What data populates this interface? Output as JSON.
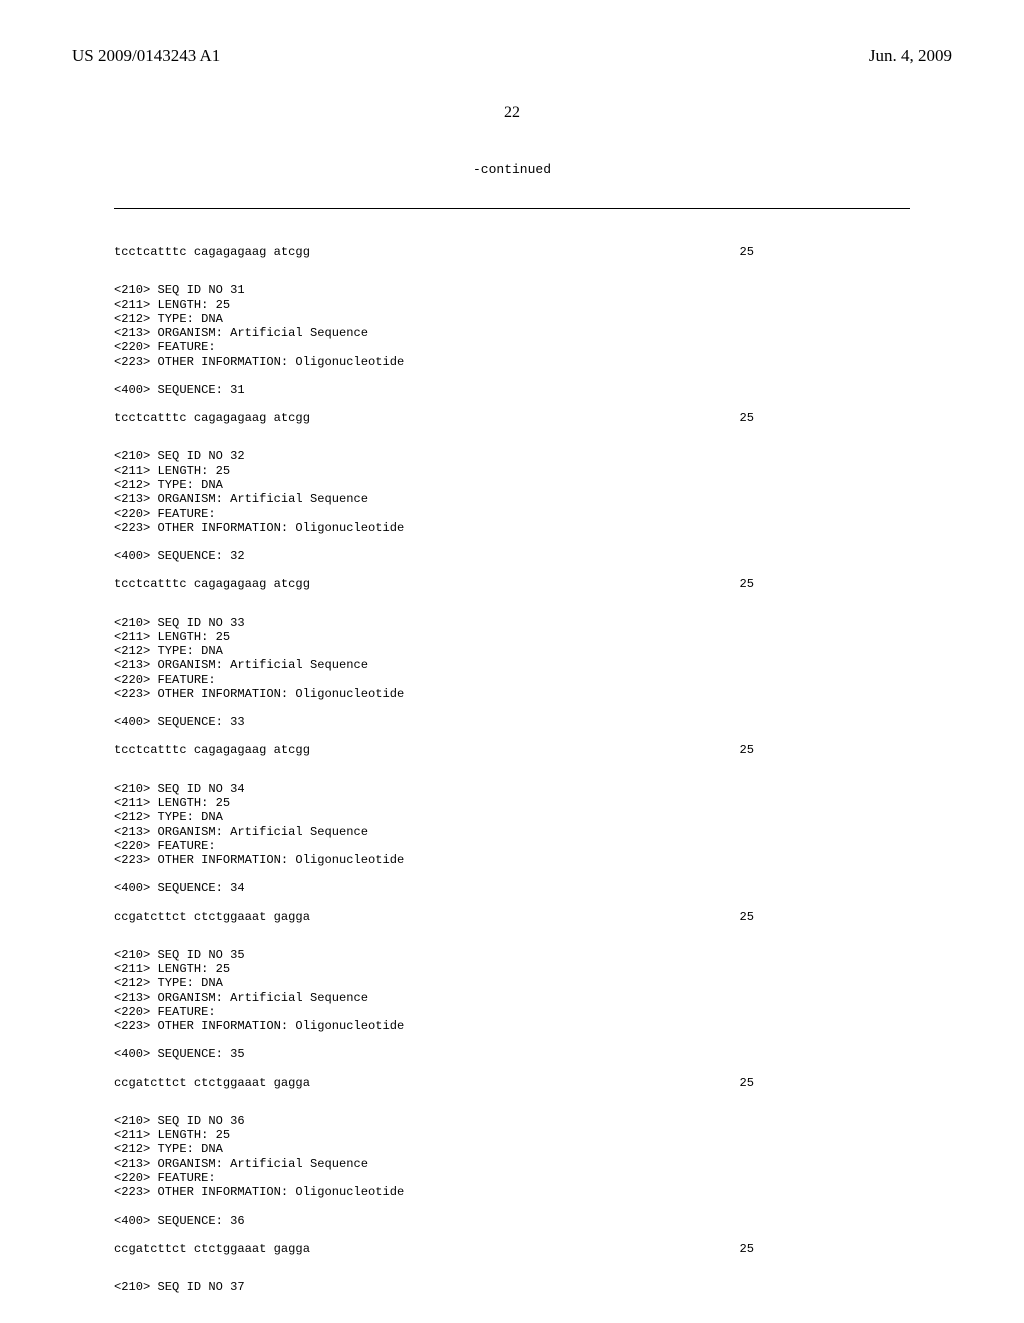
{
  "header": {
    "pubno": "US 2009/0143243 A1",
    "pubdate": "Jun. 4, 2009"
  },
  "page_number": "22",
  "continued_label": "-continued",
  "entries": [
    {
      "type": "seq",
      "sequence": "tcctcatttc cagagagaag atcgg",
      "length": "25"
    },
    {
      "type": "gap"
    },
    {
      "type": "meta",
      "lines": [
        "<210> SEQ ID NO 31",
        "<211> LENGTH: 25",
        "<212> TYPE: DNA",
        "<213> ORGANISM: Artificial Sequence",
        "<220> FEATURE:",
        "<223> OTHER INFORMATION: Oligonucleotide"
      ]
    },
    {
      "type": "smallgap"
    },
    {
      "type": "line",
      "text": "<400> SEQUENCE: 31"
    },
    {
      "type": "smallgap"
    },
    {
      "type": "seq",
      "sequence": "tcctcatttc cagagagaag atcgg",
      "length": "25"
    },
    {
      "type": "gap"
    },
    {
      "type": "meta",
      "lines": [
        "<210> SEQ ID NO 32",
        "<211> LENGTH: 25",
        "<212> TYPE: DNA",
        "<213> ORGANISM: Artificial Sequence",
        "<220> FEATURE:",
        "<223> OTHER INFORMATION: Oligonucleotide"
      ]
    },
    {
      "type": "smallgap"
    },
    {
      "type": "line",
      "text": "<400> SEQUENCE: 32"
    },
    {
      "type": "smallgap"
    },
    {
      "type": "seq",
      "sequence": "tcctcatttc cagagagaag atcgg",
      "length": "25"
    },
    {
      "type": "gap"
    },
    {
      "type": "meta",
      "lines": [
        "<210> SEQ ID NO 33",
        "<211> LENGTH: 25",
        "<212> TYPE: DNA",
        "<213> ORGANISM: Artificial Sequence",
        "<220> FEATURE:",
        "<223> OTHER INFORMATION: Oligonucleotide"
      ]
    },
    {
      "type": "smallgap"
    },
    {
      "type": "line",
      "text": "<400> SEQUENCE: 33"
    },
    {
      "type": "smallgap"
    },
    {
      "type": "seq",
      "sequence": "tcctcatttc cagagagaag atcgg",
      "length": "25"
    },
    {
      "type": "gap"
    },
    {
      "type": "meta",
      "lines": [
        "<210> SEQ ID NO 34",
        "<211> LENGTH: 25",
        "<212> TYPE: DNA",
        "<213> ORGANISM: Artificial Sequence",
        "<220> FEATURE:",
        "<223> OTHER INFORMATION: Oligonucleotide"
      ]
    },
    {
      "type": "smallgap"
    },
    {
      "type": "line",
      "text": "<400> SEQUENCE: 34"
    },
    {
      "type": "smallgap"
    },
    {
      "type": "seq",
      "sequence": "ccgatcttct ctctggaaat gagga",
      "length": "25"
    },
    {
      "type": "gap"
    },
    {
      "type": "meta",
      "lines": [
        "<210> SEQ ID NO 35",
        "<211> LENGTH: 25",
        "<212> TYPE: DNA",
        "<213> ORGANISM: Artificial Sequence",
        "<220> FEATURE:",
        "<223> OTHER INFORMATION: Oligonucleotide"
      ]
    },
    {
      "type": "smallgap"
    },
    {
      "type": "line",
      "text": "<400> SEQUENCE: 35"
    },
    {
      "type": "smallgap"
    },
    {
      "type": "seq",
      "sequence": "ccgatcttct ctctggaaat gagga",
      "length": "25"
    },
    {
      "type": "gap"
    },
    {
      "type": "meta",
      "lines": [
        "<210> SEQ ID NO 36",
        "<211> LENGTH: 25",
        "<212> TYPE: DNA",
        "<213> ORGANISM: Artificial Sequence",
        "<220> FEATURE:",
        "<223> OTHER INFORMATION: Oligonucleotide"
      ]
    },
    {
      "type": "smallgap"
    },
    {
      "type": "line",
      "text": "<400> SEQUENCE: 36"
    },
    {
      "type": "smallgap"
    },
    {
      "type": "seq",
      "sequence": "ccgatcttct ctctggaaat gagga",
      "length": "25"
    },
    {
      "type": "gap"
    },
    {
      "type": "line",
      "text": "<210> SEQ ID NO 37"
    }
  ]
}
